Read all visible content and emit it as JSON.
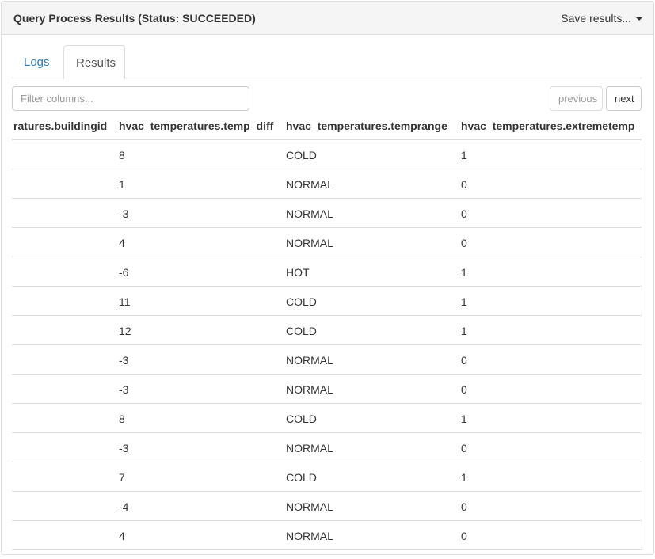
{
  "header": {
    "title": "Query Process Results (Status: SUCCEEDED)",
    "save_label": "Save results..."
  },
  "tabs": [
    {
      "label": "Logs",
      "active": false
    },
    {
      "label": "Results",
      "active": true
    }
  ],
  "filter": {
    "placeholder": "Filter columns...",
    "value": ""
  },
  "pager": {
    "previous": "previous",
    "next": "next"
  },
  "table": {
    "columns": [
      "ratures.buildingid",
      "hvac_temperatures.temp_diff",
      "hvac_temperatures.temprange",
      "hvac_temperatures.extremetemp"
    ],
    "rows": [
      [
        "",
        "8",
        "COLD",
        "1"
      ],
      [
        "",
        "1",
        "NORMAL",
        "0"
      ],
      [
        "",
        "-3",
        "NORMAL",
        "0"
      ],
      [
        "",
        "4",
        "NORMAL",
        "0"
      ],
      [
        "",
        "-6",
        "HOT",
        "1"
      ],
      [
        "",
        "11",
        "COLD",
        "1"
      ],
      [
        "",
        "12",
        "COLD",
        "1"
      ],
      [
        "",
        "-3",
        "NORMAL",
        "0"
      ],
      [
        "",
        "-3",
        "NORMAL",
        "0"
      ],
      [
        "",
        "8",
        "COLD",
        "1"
      ],
      [
        "",
        "-3",
        "NORMAL",
        "0"
      ],
      [
        "",
        "7",
        "COLD",
        "1"
      ],
      [
        "",
        "-4",
        "NORMAL",
        "0"
      ],
      [
        "",
        "4",
        "NORMAL",
        "0"
      ]
    ]
  }
}
